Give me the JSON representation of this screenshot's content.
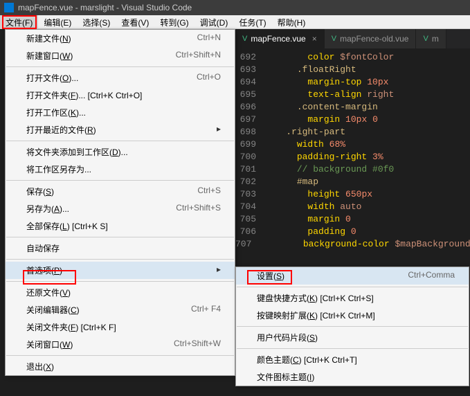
{
  "window_title": "mapFence.vue - marslight - Visual Studio Code",
  "menubar": [
    "文件(F)",
    "编辑(E)",
    "选择(S)",
    "查看(V)",
    "转到(G)",
    "调试(D)",
    "任务(T)",
    "帮助(H)"
  ],
  "tabs": [
    {
      "label": "mapFence.vue",
      "active": true
    },
    {
      "label": "mapFence-old.vue",
      "active": false
    },
    {
      "label": "m",
      "active": false
    }
  ],
  "code": {
    "start": 692,
    "lines": [
      {
        "indent": 4,
        "html": "<span class='c-prop'>color</span> <span class='c-var'>$fontColor</span>"
      },
      {
        "indent": 3,
        "html": "<span class='c-sel'>.floatRight</span>"
      },
      {
        "indent": 4,
        "html": "<span class='c-prop'>margin-top</span> <span class='c-num'>10px</span>"
      },
      {
        "indent": 4,
        "html": "<span class='c-prop'>text-align</span> <span class='c-kw'>right</span>"
      },
      {
        "indent": 3,
        "html": "<span class='c-sel'>.content-margin</span>"
      },
      {
        "indent": 4,
        "html": "<span class='c-prop'>margin</span> <span class='c-num'>10px</span> <span class='c-num'>0</span>"
      },
      {
        "indent": 2,
        "html": "<span class='c-sel'>.right-part</span>"
      },
      {
        "indent": 3,
        "html": "<span class='c-prop'>width</span> <span class='c-num'>68%</span>"
      },
      {
        "indent": 3,
        "html": "<span class='c-prop'>padding-right</span> <span class='c-num'>3%</span>"
      },
      {
        "indent": 3,
        "html": "<span class='c-comment'>// background #0f0</span>"
      },
      {
        "indent": 3,
        "html": "<span class='c-sel'>#map</span>"
      },
      {
        "indent": 4,
        "html": "<span class='c-prop'>height</span> <span class='c-num'>650px</span>"
      },
      {
        "indent": 4,
        "html": "<span class='c-prop'>width</span> <span class='c-kw'>auto</span>"
      },
      {
        "indent": 4,
        "html": "<span class='c-prop'>margin</span> <span class='c-num'>0</span>"
      },
      {
        "indent": 4,
        "html": "<span class='c-prop'>padding</span> <span class='c-num'>0</span>"
      },
      {
        "indent": 4,
        "html": "<span class='c-prop'>background-color</span> <span class='c-var'>$mapBackground</span>"
      }
    ]
  },
  "file_menu": [
    {
      "type": "item",
      "label": "新建文件(N)",
      "u": "N",
      "shortcut": "Ctrl+N"
    },
    {
      "type": "item",
      "label": "新建窗口(W)",
      "u": "W",
      "shortcut": "Ctrl+Shift+N"
    },
    {
      "type": "sep"
    },
    {
      "type": "item",
      "label": "打开文件(O)...",
      "u": "O",
      "shortcut": "Ctrl+O"
    },
    {
      "type": "item",
      "label": "打开文件夹(F)... [Ctrl+K Ctrl+O]",
      "u": "F"
    },
    {
      "type": "item",
      "label": "打开工作区(K)...",
      "u": "K"
    },
    {
      "type": "item",
      "label": "打开最近的文件(R)",
      "u": "R",
      "arrow": true
    },
    {
      "type": "sep"
    },
    {
      "type": "item",
      "label": "将文件夹添加到工作区(D)...",
      "u": "D"
    },
    {
      "type": "item",
      "label": "将工作区另存为...",
      "u": ""
    },
    {
      "type": "sep"
    },
    {
      "type": "item",
      "label": "保存(S)",
      "u": "S",
      "shortcut": "Ctrl+S"
    },
    {
      "type": "item",
      "label": "另存为(A)...",
      "u": "A",
      "shortcut": "Ctrl+Shift+S"
    },
    {
      "type": "item",
      "label": "全部保存(L) [Ctrl+K S]",
      "u": "L"
    },
    {
      "type": "sep"
    },
    {
      "type": "item",
      "label": "自动保存",
      "u": ""
    },
    {
      "type": "sep"
    },
    {
      "type": "item",
      "label": "首选项(P)",
      "u": "P",
      "arrow": true,
      "hover": true,
      "name": "preferences"
    },
    {
      "type": "sep"
    },
    {
      "type": "item",
      "label": "还原文件(V)",
      "u": "V"
    },
    {
      "type": "item",
      "label": "关闭编辑器(C)",
      "u": "C",
      "shortcut": "Ctrl+  F4"
    },
    {
      "type": "item",
      "label": "关闭文件夹(F) [Ctrl+K F]",
      "u": "F"
    },
    {
      "type": "item",
      "label": "关闭窗口(W)",
      "u": "W",
      "shortcut": "Ctrl+Shift+W"
    },
    {
      "type": "sep"
    },
    {
      "type": "item",
      "label": "退出(X)",
      "u": "X"
    }
  ],
  "sub_menu": [
    {
      "type": "item",
      "label": "设置(S)",
      "u": "S",
      "shortcut": "Ctrl+Comma",
      "hover": true,
      "name": "settings"
    },
    {
      "type": "sep"
    },
    {
      "type": "item",
      "label": "键盘快捷方式(K) [Ctrl+K Ctrl+S]",
      "u": "K"
    },
    {
      "type": "item",
      "label": "按键映射扩展(K) [Ctrl+K Ctrl+M]",
      "u": "K"
    },
    {
      "type": "sep"
    },
    {
      "type": "item",
      "label": "用户代码片段(S)",
      "u": "S"
    },
    {
      "type": "sep"
    },
    {
      "type": "item",
      "label": "颜色主题(C) [Ctrl+K Ctrl+T]",
      "u": "C"
    },
    {
      "type": "item",
      "label": "文件图标主题(I)",
      "u": "I"
    }
  ]
}
